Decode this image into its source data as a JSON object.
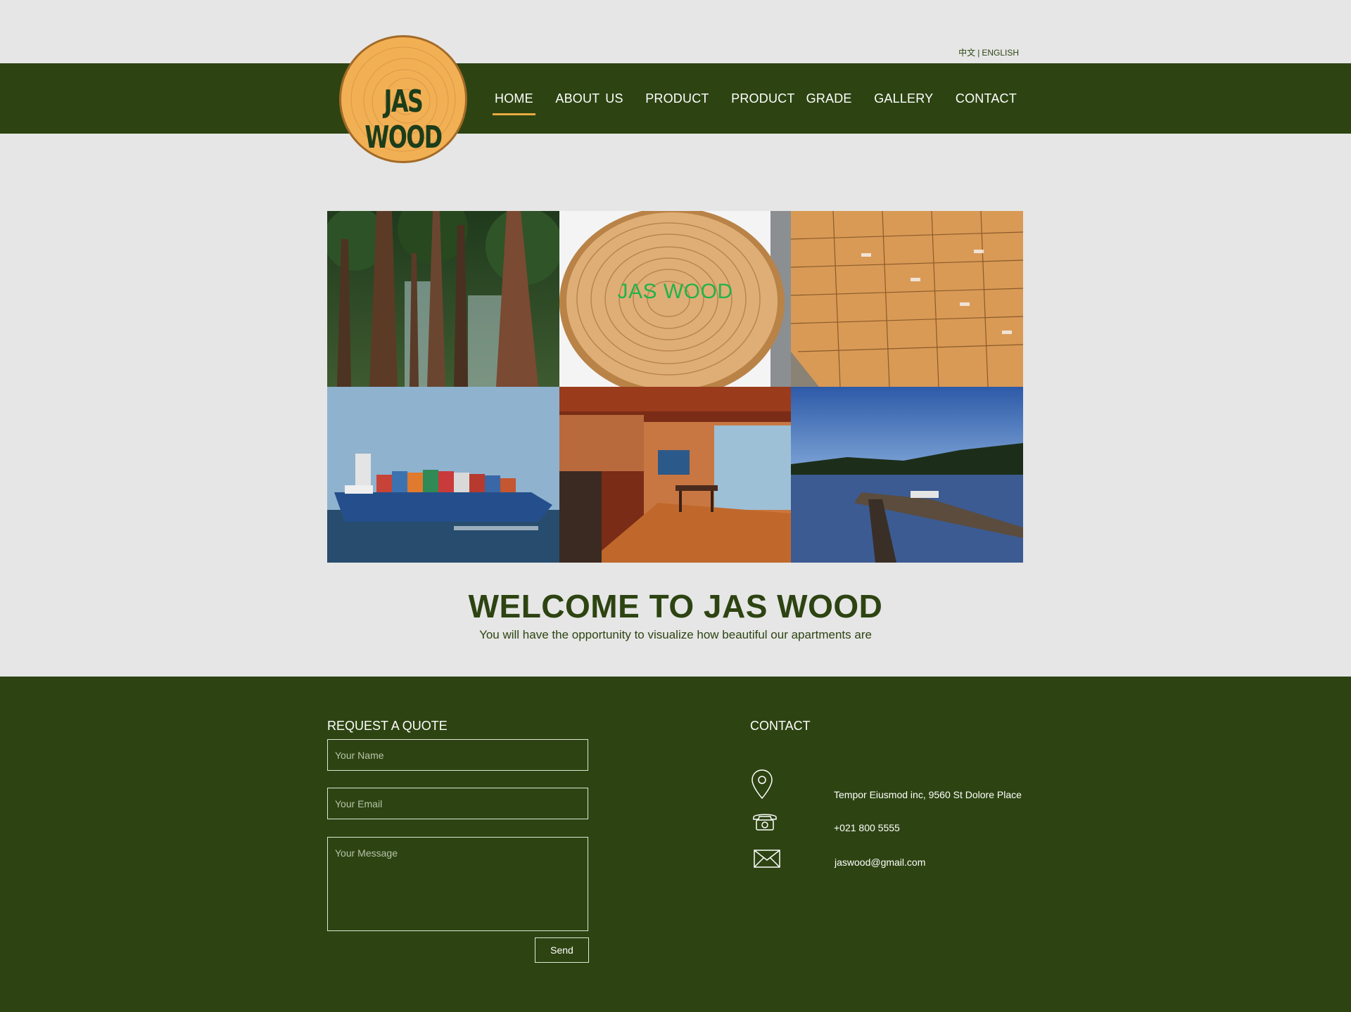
{
  "language": {
    "chinese": "中文",
    "separator": "|",
    "english": "ENGLISH"
  },
  "logo": {
    "text": "JAS WOOD"
  },
  "nav": {
    "items": [
      {
        "label": "HOME",
        "active": true
      },
      {
        "label": "ABOUT US",
        "active": false
      },
      {
        "label": "PRODUCT",
        "active": false
      },
      {
        "label": "PRODUCT  GRADE",
        "active": false
      },
      {
        "label": "GALLERY",
        "active": false
      },
      {
        "label": "CONTACT",
        "active": false
      }
    ]
  },
  "gallery": {
    "caption": "JAS WOOD",
    "tiles": [
      "redwood-forest-photo",
      "log-cross-section-photo",
      "stacked-lumber-photo",
      "container-ship-photo",
      "wooden-interior-photo",
      "lake-jetty-photo"
    ]
  },
  "welcome": {
    "title": "WELCOME TO JAS WOOD",
    "subtitle": "You will have the opportunity to visualize how beautiful our apartments are"
  },
  "quote_form": {
    "heading": "REQUEST A QUOTE",
    "name_placeholder": "Your Name",
    "email_placeholder": "Your Email",
    "message_placeholder": "Your Message",
    "send_label": "Send"
  },
  "contact": {
    "heading": "CONTACT",
    "address": "Tempor Eiusmod inc, 9560 St Dolore Place",
    "phone": "+021 800 5555",
    "email": "jaswood@gmail.com"
  },
  "colors": {
    "brand_green": "#2d4412",
    "background": "#e6e6e6",
    "accent_orange": "#e9a941",
    "logo_fill": "#f2b055",
    "caption_green": "#23b24a"
  }
}
